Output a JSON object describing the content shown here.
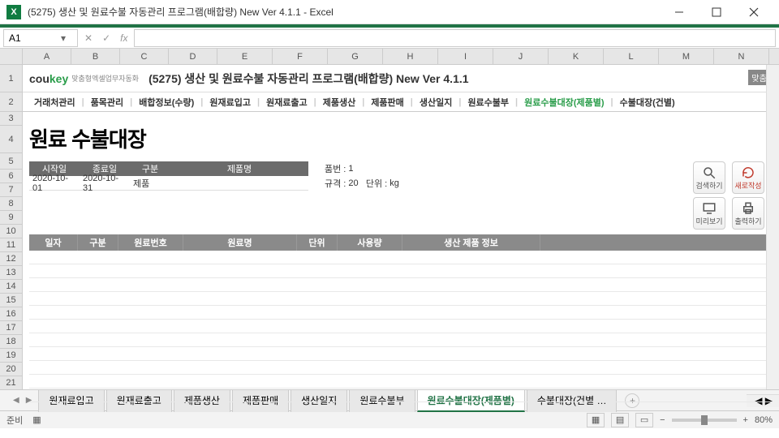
{
  "window": {
    "title": "(5275) 생산 및 원료수불 자동관리 프로그램(배합량) New Ver 4.1.1 - Excel"
  },
  "formula": {
    "cell_ref": "A1",
    "fx": "fx"
  },
  "columns": [
    "A",
    "B",
    "C",
    "D",
    "E",
    "F",
    "G",
    "H",
    "I",
    "J",
    "K",
    "L",
    "M",
    "N"
  ],
  "rows": [
    "1",
    "2",
    "3",
    "4",
    "5",
    "6",
    "7",
    "8",
    "9",
    "10",
    "11",
    "12",
    "13",
    "14",
    "15",
    "16",
    "17",
    "18",
    "19",
    "20",
    "21"
  ],
  "app": {
    "logo_cou": "cou",
    "logo_key": "key",
    "logo_sub": "맞춤형엑셀업무자동화",
    "title": "(5275) 생산 및 원료수불 자동관리 프로그램(배합량) New Ver 4.1.1",
    "badge": "맞춤제"
  },
  "nav": {
    "items": [
      "거래처관리",
      "품목관리",
      "배합정보(수량)",
      "원재료입고",
      "원재료출고",
      "제품생산",
      "제품판매",
      "생산일지",
      "원료수불부",
      "원료수불대장(제품별)",
      "수불대장(건별)"
    ],
    "active_index": 9
  },
  "page_title": "원료 수불대장",
  "filter": {
    "headers": [
      "시작일",
      "종료일",
      "구분",
      "제품명"
    ],
    "values": [
      "2020-10-01",
      "2020-10-31",
      "제품",
      ""
    ]
  },
  "meta": {
    "line1_label": "품번 :",
    "line1_value": "1",
    "line2_label1": "규격 :",
    "line2_value1": "20",
    "line2_label2": "단위 :",
    "line2_value2": "kg"
  },
  "actions": {
    "search": "검색하기",
    "new": "새로작성",
    "preview": "미리보기",
    "print": "출력하기"
  },
  "data_headers": [
    "일자",
    "구분",
    "원료번호",
    "원료명",
    "단위",
    "사용량",
    "생산 제품 정보"
  ],
  "sheet_tabs": {
    "items": [
      "원재료입고",
      "원재료출고",
      "제품생산",
      "제품판매",
      "생산일지",
      "원료수불부",
      "원료수불대장(제품별)",
      "수불대장(건별 …"
    ],
    "active_index": 6
  },
  "status": {
    "ready": "준비",
    "zoom": "80%",
    "plus": "+",
    "minus": "−"
  }
}
